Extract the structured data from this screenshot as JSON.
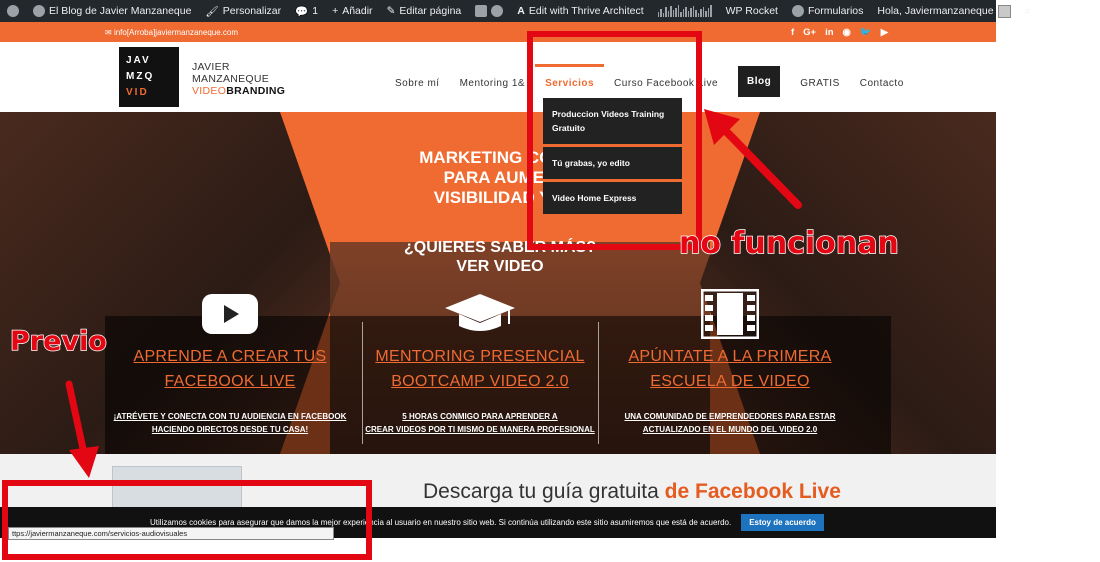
{
  "admin_bar": {
    "site": "El Blog de Javier Manzaneque",
    "customize": "Personalizar",
    "comments": "1",
    "add": "Añadir",
    "edit": "Editar página",
    "thrive": "Edit with Thrive Architect",
    "wprocket": "WP Rocket",
    "forms": "Formularios",
    "greeting": "Hola, Javiermanzaneque"
  },
  "topbar": {
    "email": "info[Arroba]javiermanzaneque.com",
    "social": [
      "f",
      "G+",
      "in",
      "rss",
      "tw",
      "yt"
    ]
  },
  "logo": {
    "row1": "JAV",
    "row2": "MZQ",
    "row3": "VID",
    "name1": "JAVIER",
    "name2": "MANZANEQUE",
    "tag_video": "VIDEO",
    "tag_branding": "BRANDING"
  },
  "nav": [
    "Sobre mí",
    "Mentoring 1&",
    "Servicios",
    "Curso Facebook Live",
    "Blog",
    "GRATIS",
    "Contacto"
  ],
  "dropdown": [
    "Produccion Videos Training Gratuito",
    "Tú grabas, yo edito",
    "Video Home Express"
  ],
  "hero": {
    "title": "MARKETING CON V... PARA AUMENT... VISIBILIDAD Y ...",
    "title_line1": "MARKETING CON V",
    "title_line2": "PARA AUMEN",
    "title_line3": "VISIBILIDAD Y V",
    "sub_line1": "¿QUIERES SABER MÁS?",
    "sub_line2": "VER VIDEO",
    "columns": [
      {
        "head1": "APRENDE A CREAR TUS",
        "head2": "FACEBOOK LIVE",
        "desc1": "¡ATRÉVETE Y CONECTA CON TU AUDIENCIA EN FACEBOOK",
        "desc2": "HACIENDO DIRECTOS DESDE TU CASA!"
      },
      {
        "head1": "MENTORING PRESENCIAL",
        "head2": "BOOTCAMP VIDEO 2.0",
        "desc1": "5 HORAS CONMIGO PARA APRENDER A",
        "desc2": "CREAR VIDEOS POR TI MISMO DE MANERA PROFESIONAL"
      },
      {
        "head1": "APÚNTATE A LA PRIMERA",
        "head2": "ESCUELA DE VIDEO",
        "desc1": "UNA COMUNIDAD DE EMPRENDEDORES PARA ESTAR",
        "desc2": "ACTUALIZADO EN EL MUNDO DEL VIDEO 2.0"
      }
    ]
  },
  "download": {
    "title_plain": "Descarga tu guía gratuita ",
    "title_accent": "de Facebook Live"
  },
  "cookie": {
    "text": "Utilizamos cookies para asegurar que damos la mejor experiencia al usuario en nuestro sitio web. Si continúa utilizando este sitio asumiremos que está de acuerdo.",
    "button": "Estoy de acuerdo"
  },
  "status_url": "ttps://javiermanzaneque.com/servicios-audiovisuales",
  "annotations": {
    "note1": "no funcionan",
    "note2": "Previo"
  },
  "colors": {
    "accent": "#ef6b32",
    "annotation": "#e30613",
    "adminbar": "#23282d"
  }
}
